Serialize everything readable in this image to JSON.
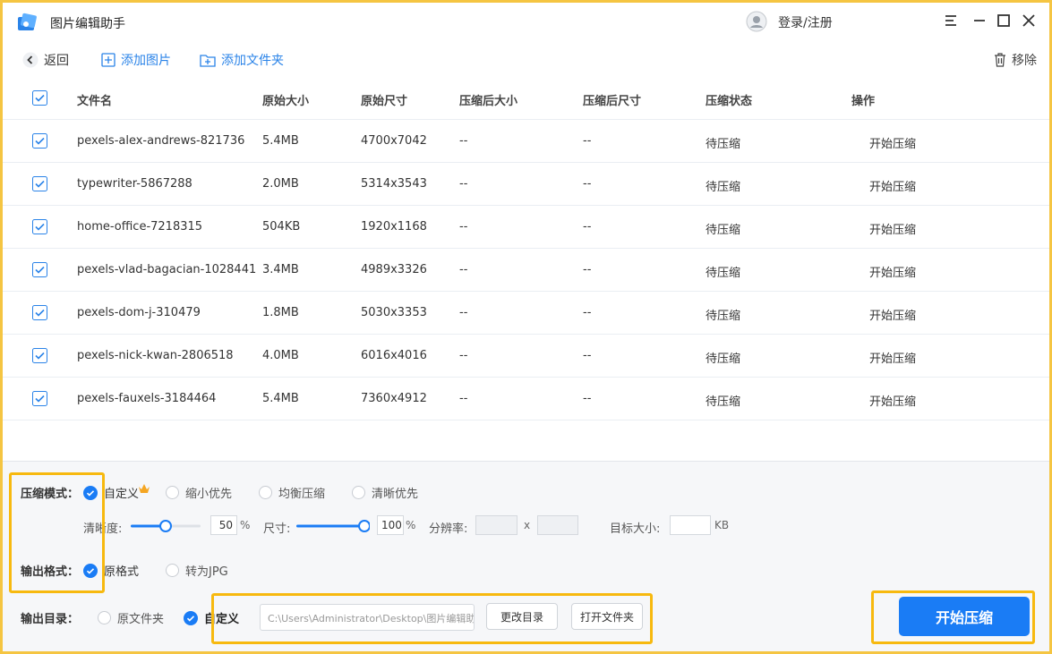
{
  "app": {
    "title": "图片编辑助手",
    "login": "登录/注册"
  },
  "toolbar": {
    "back": "返回",
    "add_image": "添加图片",
    "add_folder": "添加文件夹",
    "remove": "移除"
  },
  "table": {
    "headers": [
      "文件名",
      "原始大小",
      "原始尺寸",
      "压缩后大小",
      "压缩后尺寸",
      "压缩状态",
      "操作"
    ],
    "rows": [
      {
        "name": "pexels-alex-andrews-821736",
        "size": "5.4MB",
        "dim": "4700x7042",
        "csize": "--",
        "cdim": "--",
        "status": "待压缩",
        "op": "开始压缩"
      },
      {
        "name": "typewriter-5867288",
        "size": "2.0MB",
        "dim": "5314x3543",
        "csize": "--",
        "cdim": "--",
        "status": "待压缩",
        "op": "开始压缩"
      },
      {
        "name": "home-office-7218315",
        "size": "504KB",
        "dim": "1920x1168",
        "csize": "--",
        "cdim": "--",
        "status": "待压缩",
        "op": "开始压缩"
      },
      {
        "name": "pexels-vlad-bagacian-1028441",
        "size": "3.4MB",
        "dim": "4989x3326",
        "csize": "--",
        "cdim": "--",
        "status": "待压缩",
        "op": "开始压缩"
      },
      {
        "name": "pexels-dom-j-310479",
        "size": "1.8MB",
        "dim": "5030x3353",
        "csize": "--",
        "cdim": "--",
        "status": "待压缩",
        "op": "开始压缩"
      },
      {
        "name": "pexels-nick-kwan-2806518",
        "size": "4.0MB",
        "dim": "6016x4016",
        "csize": "--",
        "cdim": "--",
        "status": "待压缩",
        "op": "开始压缩"
      },
      {
        "name": "pexels-fauxels-3184464",
        "size": "5.4MB",
        "dim": "7360x4912",
        "csize": "--",
        "cdim": "--",
        "status": "待压缩",
        "op": "开始压缩"
      }
    ]
  },
  "settings": {
    "mode_label": "压缩模式：",
    "modes": [
      "自定义",
      "缩小优先",
      "均衡压缩",
      "清晰优先"
    ],
    "selected_mode": "自定义",
    "clarity_label": "清晰度:",
    "clarity_value": "50",
    "clarity_percent": 50,
    "clarity_unit": "%",
    "size_label": "尺寸:",
    "size_value": "100",
    "size_percent": 100,
    "size_unit": "%",
    "resolution_label": "分辨率:",
    "resolution_x": "",
    "resolution_sep": "x",
    "resolution_y": "",
    "target_label": "目标大小:",
    "target_value": "",
    "target_unit": "KB",
    "format_label": "输出格式：",
    "formats": [
      "原格式",
      "转为JPG"
    ],
    "selected_format": "原格式",
    "dir_label": "输出目录：",
    "dirs": [
      "原文件夹",
      "自定义"
    ],
    "selected_dir": "自定义",
    "path": "C:\\Users\\Administrator\\Desktop\\图片编辑助手",
    "change_dir": "更改目录",
    "open_folder": "打开文件夹",
    "start": "开始压缩"
  },
  "colors": {
    "accent": "#1a7cf5",
    "highlight": "#f7b90f"
  }
}
